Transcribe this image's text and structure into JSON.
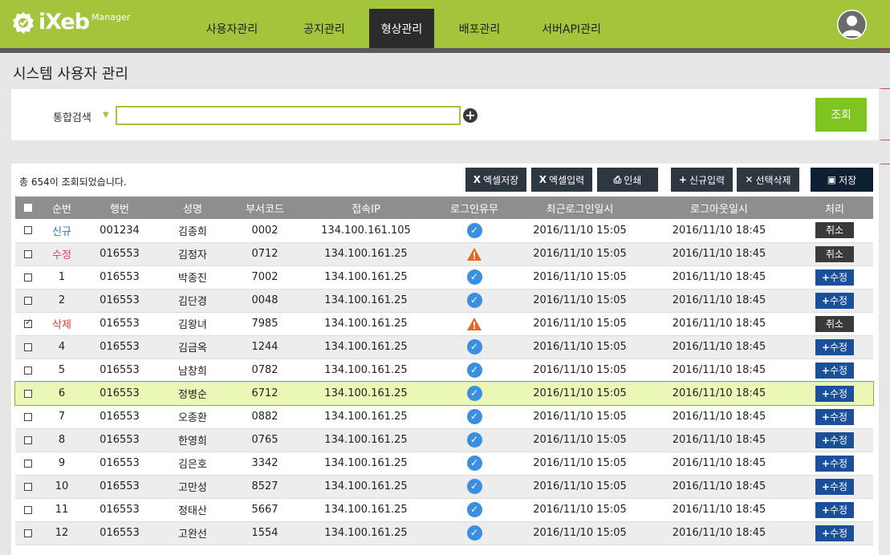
{
  "header": {
    "logo_text": "iXeb",
    "logo_sup": "Manager",
    "nav": [
      {
        "label": "사용자관리"
      },
      {
        "label": "공지관리"
      },
      {
        "label": "형상관리"
      },
      {
        "label": "배포관리"
      },
      {
        "label": "서버API관리"
      }
    ],
    "active_nav": "형상관리",
    "avatar_icon": "user-avatar-icon"
  },
  "page_title": "시스템 사용자 관리",
  "search": {
    "label": "통합검색",
    "value": "",
    "button_label": "조회"
  },
  "toolbar": {
    "result_text": "총 654이 조회되었습니다.",
    "excel_save": "엑셀저장",
    "excel_import": "엑셀입력",
    "print": "인쇄",
    "add": "신규입력",
    "delete_selected": "선택삭제",
    "save": "저장"
  },
  "table": {
    "columns": [
      "순번",
      "행번",
      "성명",
      "부서코드",
      "접속IP",
      "로그인유무",
      "최근로그인일시",
      "로그아웃일시",
      "처리"
    ],
    "rows": [
      {
        "checked": false,
        "seq": "신규",
        "seq_type": "new",
        "emp_no": "001234",
        "name": "김종희",
        "dept": "0002",
        "ip": "134.100.161.105",
        "login": "ok",
        "last_login": "2016/11/10 15:05",
        "logout": "2016/11/10 18:45",
        "action": "취소"
      },
      {
        "checked": false,
        "seq": "수정",
        "seq_type": "mod",
        "emp_no": "016553",
        "name": "김정자",
        "dept": "0712",
        "ip": "134.100.161.25",
        "login": "warn",
        "last_login": "2016/11/10 15:05",
        "logout": "2016/11/10 18:45",
        "action": "취소"
      },
      {
        "checked": false,
        "seq": "1",
        "seq_type": "num",
        "emp_no": "016553",
        "name": "박종진",
        "dept": "7002",
        "ip": "134.100.161.25",
        "login": "ok",
        "last_login": "2016/11/10 15:05",
        "logout": "2016/11/10 18:45",
        "action": "수정"
      },
      {
        "checked": false,
        "seq": "2",
        "seq_type": "num",
        "emp_no": "016553",
        "name": "김단경",
        "dept": "0048",
        "ip": "134.100.161.25",
        "login": "ok",
        "last_login": "2016/11/10 15:05",
        "logout": "2016/11/10 18:45",
        "action": "수정"
      },
      {
        "checked": true,
        "seq": "삭제",
        "seq_type": "del",
        "emp_no": "016553",
        "name": "김왕녀",
        "dept": "7985",
        "ip": "134.100.161.25",
        "login": "warn",
        "last_login": "2016/11/10 15:05",
        "logout": "2016/11/10 18:45",
        "action": "취소"
      },
      {
        "checked": false,
        "seq": "4",
        "seq_type": "num",
        "emp_no": "016553",
        "name": "김금옥",
        "dept": "1244",
        "ip": "134.100.161.25",
        "login": "ok",
        "last_login": "2016/11/10 15:05",
        "logout": "2016/11/10 18:45",
        "action": "수정"
      },
      {
        "checked": false,
        "seq": "5",
        "seq_type": "num",
        "emp_no": "016553",
        "name": "남창희",
        "dept": "0782",
        "ip": "134.100.161.25",
        "login": "ok",
        "last_login": "2016/11/10 15:05",
        "logout": "2016/11/10 18:45",
        "action": "수정"
      },
      {
        "checked": false,
        "seq": "6",
        "seq_type": "num",
        "emp_no": "016553",
        "name": "정병순",
        "dept": "6712",
        "ip": "134.100.161.25",
        "login": "ok",
        "last_login": "2016/11/10 15:05",
        "logout": "2016/11/10 18:45",
        "action": "수정",
        "highlight": true
      },
      {
        "checked": false,
        "seq": "7",
        "seq_type": "num",
        "emp_no": "016553",
        "name": "오종환",
        "dept": "0882",
        "ip": "134.100.161.25",
        "login": "ok",
        "last_login": "2016/11/10 15:05",
        "logout": "2016/11/10 18:45",
        "action": "수정"
      },
      {
        "checked": false,
        "seq": "8",
        "seq_type": "num",
        "emp_no": "016553",
        "name": "한영희",
        "dept": "0765",
        "ip": "134.100.161.25",
        "login": "ok",
        "last_login": "2016/11/10 15:05",
        "logout": "2016/11/10 18:45",
        "action": "수정"
      },
      {
        "checked": false,
        "seq": "9",
        "seq_type": "num",
        "emp_no": "016553",
        "name": "김은호",
        "dept": "3342",
        "ip": "134.100.161.25",
        "login": "ok",
        "last_login": "2016/11/10 15:05",
        "logout": "2016/11/10 18:45",
        "action": "수정"
      },
      {
        "checked": false,
        "seq": "10",
        "seq_type": "num",
        "emp_no": "016553",
        "name": "고만성",
        "dept": "8527",
        "ip": "134.100.161.25",
        "login": "ok",
        "last_login": "2016/11/10 15:05",
        "logout": "2016/11/10 18:45",
        "action": "수정"
      },
      {
        "checked": false,
        "seq": "11",
        "seq_type": "num",
        "emp_no": "016553",
        "name": "정태산",
        "dept": "5667",
        "ip": "134.100.161.25",
        "login": "ok",
        "last_login": "2016/11/10 15:05",
        "logout": "2016/11/10 18:45",
        "action": "수정"
      },
      {
        "checked": false,
        "seq": "12",
        "seq_type": "num",
        "emp_no": "016553",
        "name": "고완선",
        "dept": "1554",
        "ip": "134.100.161.25",
        "login": "ok",
        "last_login": "2016/11/10 15:05",
        "logout": "2016/11/10 18:45",
        "action": "수정"
      }
    ]
  },
  "colors": {
    "brand_green": "#a2c53b",
    "search_button": "#7fc520",
    "edit_button": "#1a4f9a",
    "cancel_button": "#3a3a3a",
    "ok_icon": "#3a8fe0",
    "warn_icon": "#e8661c",
    "highlight_row": "#eaf7b7"
  }
}
